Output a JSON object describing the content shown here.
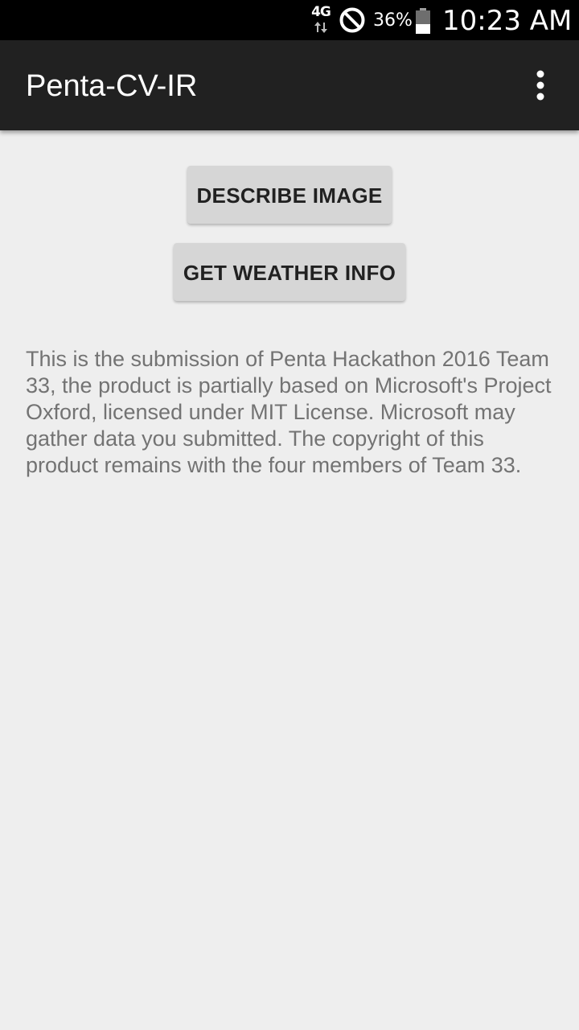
{
  "status_bar": {
    "network": "4G",
    "battery_percent": "36%",
    "time": "10:23 AM",
    "icons": [
      "network-4g-icon",
      "do-not-disturb-icon",
      "battery-icon"
    ]
  },
  "app_bar": {
    "title": "Penta-CV-IR",
    "overflow_icon": "more-vert-icon"
  },
  "main": {
    "describe_button_label": "DESCRIBE IMAGE",
    "weather_button_label": "GET WEATHER INFO",
    "info_text": "This is the submission of Penta Hackathon 2016 Team 33, the product is partially based on Microsoft's Project Oxford, licensed under MIT License. Microsoft may gather data you submitted. The copyright of this product remains with the four members of Team 33."
  },
  "colors": {
    "status_bar": "#000000",
    "app_bar": "#212121",
    "background": "#eeeeee",
    "button": "#d6d6d6",
    "body_text": "#737373"
  }
}
